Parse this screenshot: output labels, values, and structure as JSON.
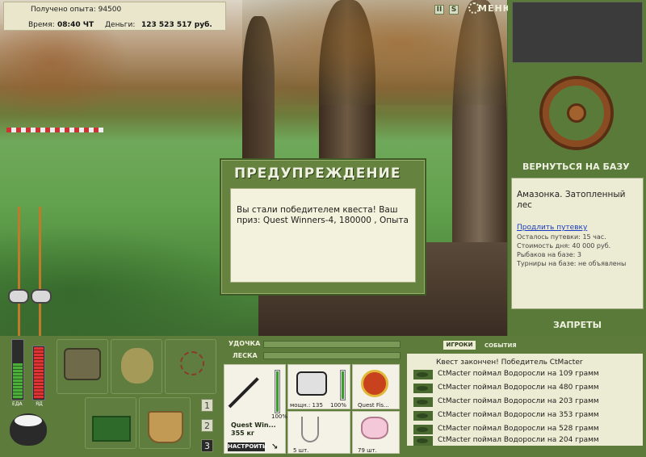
{
  "hud": {
    "xp_label": "Получено опыта: 94500",
    "time_label": "Время:",
    "time_value": "08:40 ЧТ",
    "money_label": "Деньги:",
    "money_value": "123 523 517 руб."
  },
  "topbar": {
    "pause_label": "II",
    "sound_label": "S",
    "menu_label": "МЕНЮ"
  },
  "dialog": {
    "title": "ПРЕДУПРЕЖДЕНИЕ",
    "message": "Вы стали победителем квеста! Ваш приз: Quest Winners-4, 180000 , Опыта"
  },
  "right_panel": {
    "return_label": "ВЕРНУТЬСЯ НА БАЗУ",
    "location": "Амазонка. Затопленный лес",
    "extend_link": "Продлить путевку",
    "trip_left": "Осталось путевки: 15 час.",
    "day_cost": "Стоимость дня: 40 000 руб.",
    "fishers": "Рыбаков на базе: 3",
    "tournaments": "Турниры на базе: не объявлены",
    "bans_label": "ЗАПРЕТЫ"
  },
  "status": {
    "food_label": "ЕДА",
    "poison_label": "ЯД",
    "food_level": 0.6,
    "poison_level": 0.95
  },
  "tackle": {
    "rod_label": "УДОЧКА",
    "line_label": "ЛЕСКА",
    "rod_name": "Quest Win...",
    "rod_weight": "355 кг",
    "rod_condition": "100%",
    "configure_label": "НАСТРОИТЬ",
    "reel_caption": "мощн.: 135",
    "reel_condition": "100%",
    "line_caption": "Quest Fis...",
    "hook_caption": "5 шт.",
    "bait_caption": "79 шт."
  },
  "slot_pages": [
    "1",
    "2",
    "3"
  ],
  "events": {
    "tab_players": "ИГРОКИ",
    "tab_events": "СОБЫТИЯ",
    "header": "Квест закончен! Победитель CtMacter",
    "rows": [
      "CtMacter поймал Водоросли на 109 грамм",
      "CtMacter поймал Водоросли на 480 грамм",
      "CtMacter поймал Водоросли на 203 грамм",
      "CtMacter поймал Водоросли на 353 грамм",
      "CtMacter поймал Водоросли на 528 грамм",
      "CtMacter поймал Водоросли на 204 грамм"
    ]
  },
  "colors": {
    "panel": "#5a7a3a",
    "cream": "#ecebd3",
    "dialog": "#66823f"
  }
}
